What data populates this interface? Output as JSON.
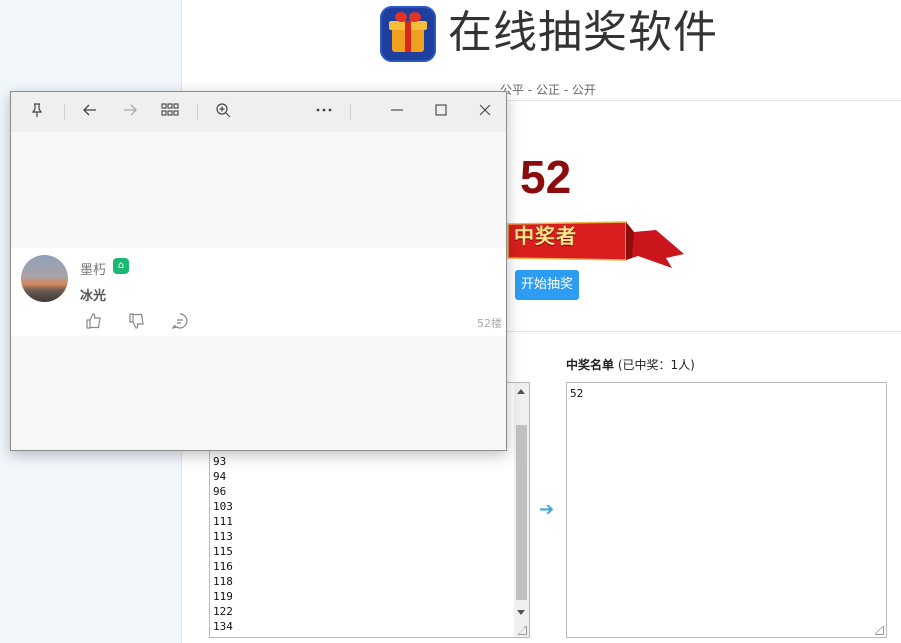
{
  "header": {
    "app_title": "在线抽奖软件",
    "subtitle": "公平 - 公正 - 公开"
  },
  "draw": {
    "winner_number": "52",
    "banner_text": "中奖者",
    "start_button": "开始抽奖"
  },
  "winners": {
    "heading_bold": "中奖名单",
    "heading_rest": " (已中奖：1人)",
    "list": [
      "52"
    ]
  },
  "participants": {
    "visible": [
      "93",
      "94",
      "96",
      "103",
      "111",
      "113",
      "115",
      "116",
      "118",
      "119",
      "122",
      "134"
    ]
  },
  "popup": {
    "comment": {
      "username": "墨朽",
      "text": "冰光",
      "floor": "52楼"
    },
    "icons": [
      "pin-icon",
      "back-arrow-icon",
      "forward-arrow-icon",
      "grid-icon",
      "zoom-in-icon",
      "more-icon",
      "minimize-icon",
      "maximize-icon",
      "close-icon"
    ]
  },
  "colors": {
    "accent": "#2c9df2",
    "winner_number": "#8b0c0c",
    "badge": "#19b873"
  }
}
